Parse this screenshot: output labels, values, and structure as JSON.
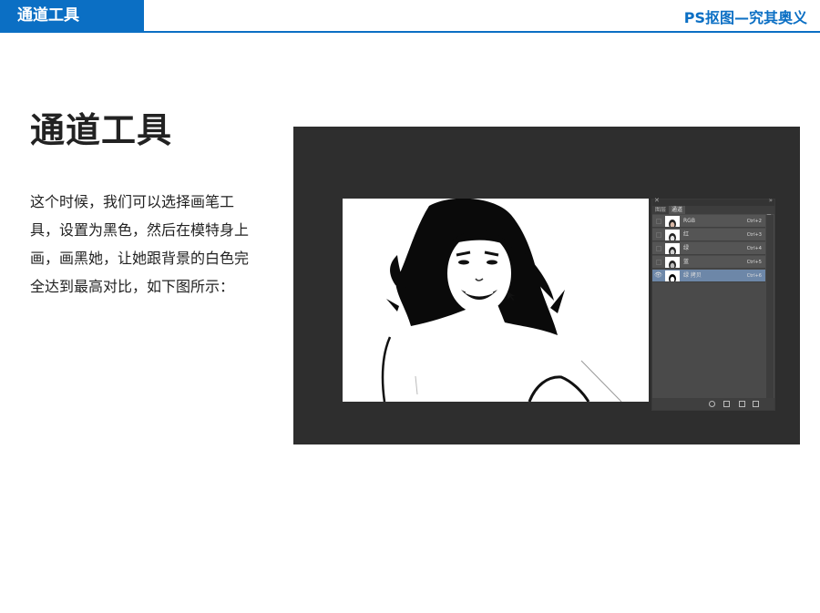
{
  "header": {
    "left_title": "通道工具",
    "right_title": "PS抠图—究其奥义"
  },
  "content": {
    "title": "通道工具",
    "paragraph": "这个时候，我们可以选择画笔工具，设置为黑色，然后在模特身上画，画黑她，让她跟背景的白色完全达到最高对比，如下图所示："
  },
  "channels_panel": {
    "tabs": [
      "图层",
      "通道"
    ],
    "active_tab": 1,
    "channels": [
      {
        "name": "RGB",
        "shortcut": "Ctrl+2",
        "visible": false,
        "selected": false
      },
      {
        "name": "红",
        "shortcut": "Ctrl+3",
        "visible": false,
        "selected": false
      },
      {
        "name": "绿",
        "shortcut": "Ctrl+4",
        "visible": false,
        "selected": false
      },
      {
        "name": "蓝",
        "shortcut": "Ctrl+5",
        "visible": false,
        "selected": false
      },
      {
        "name": "绿 拷贝",
        "shortcut": "Ctrl+6",
        "visible": true,
        "selected": true
      }
    ]
  },
  "colors": {
    "accent": "#0b6fc4",
    "app_background": "#2e2e2e",
    "panel": "#4a4a4a",
    "selected_row": "#6d87a8"
  }
}
